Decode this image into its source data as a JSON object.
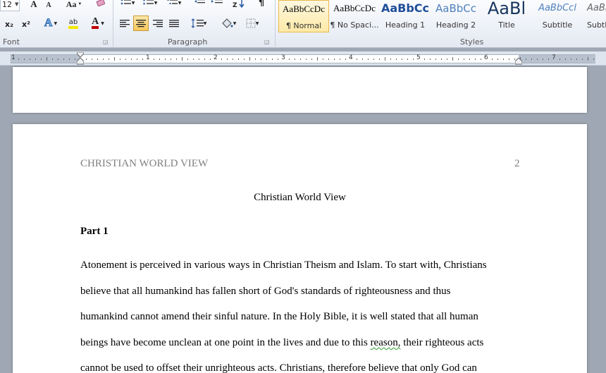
{
  "ribbon": {
    "font_size_value": "12",
    "grow_font_label": "A",
    "shrink_font_label": "A",
    "change_case_label": "Aa",
    "subscript_label": "x₂",
    "superscript_label": "x²",
    "font_color_label": "A",
    "highlight_label": "ab",
    "groups": {
      "font": "Font",
      "paragraph": "Paragraph",
      "styles": "Styles"
    },
    "styles": [
      {
        "sample": "AaBbCcDc",
        "name": "¶ Normal"
      },
      {
        "sample": "AaBbCcDc",
        "name": "¶ No Spaci..."
      },
      {
        "sample": "AaBbCc",
        "name": "Heading 1"
      },
      {
        "sample": "AaBbCc",
        "name": "Heading 2"
      },
      {
        "sample": "AaBl",
        "name": "Title"
      },
      {
        "sample": "AaBbCcl",
        "name": "Subtitle"
      },
      {
        "sample": "AaBb",
        "name": "Subtl"
      }
    ],
    "colors": {
      "highlight": "#f3e600",
      "font_color": "#c00000",
      "selected_style_border": "#e8b84b"
    }
  },
  "ruler": {
    "numbers": [
      "1",
      "1",
      "2",
      "3",
      "4",
      "5",
      "6",
      "7"
    ]
  },
  "document": {
    "header_left": "CHRISTIAN WORLD VIEW",
    "page_number": "2",
    "title": "Christian World View",
    "section_heading": "Part 1",
    "lines": [
      "Atonement is perceived in various  ways in Christian Theism  and Islam. To start with, Christians",
      "believe that all humankind has fallen short of God's standards of righteousness and thus",
      "humankind cannot amend their sinful nature. In the Holy Bible, it is well stated that all human",
      "beings have become unclean at one point in the lives and due to this ",
      "cannot be used to offset their unrighteous acts. Christians, therefore believe that only God can"
    ],
    "line4_flagged": "reason,",
    "line4_tail": " their righteous acts"
  }
}
